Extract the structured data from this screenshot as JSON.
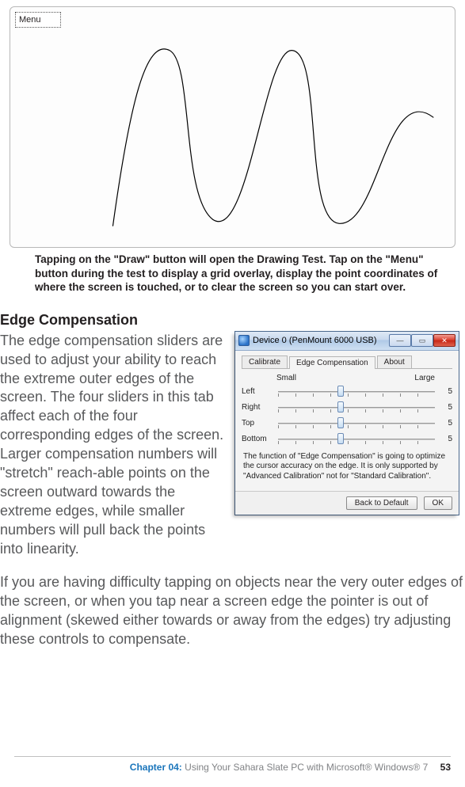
{
  "draw_test": {
    "menu_label": "Menu"
  },
  "caption": "Tapping on the \"Draw\" button will open the Drawing Test. Tap on the \"Menu\" button during the test to display a grid overlay, display the point coordinates of where the screen is touched, or to clear the screen so you can start over.",
  "heading": "Edge Compensation",
  "paragraph1": "The edge compensation sliders are used to adjust your ability to reach the extreme outer edges of the screen. The four sliders in this tab affect each of the four corresponding edges of the screen. Larger compensation numbers will \"stretch\" reach-able points on the screen outward towards the extreme edges, while smaller numbers will pull back the points into linearity.",
  "paragraph2": "If you are having difficulty tapping on objects near the very outer edges of the screen, or when you tap near a screen edge the pointer is out of alignment (skewed either towards or away from the edges) try adjusting these controls to compensate.",
  "dialog": {
    "title": "Device 0 (PenMount 6000 USB)",
    "tabs": {
      "calibrate": "Calibrate",
      "edge": "Edge Compensation",
      "about": "About"
    },
    "scale": {
      "small": "Small",
      "large": "Large"
    },
    "sliders": [
      {
        "label": "Left",
        "value": "5"
      },
      {
        "label": "Right",
        "value": "5"
      },
      {
        "label": "Top",
        "value": "5"
      },
      {
        "label": "Bottom",
        "value": "5"
      }
    ],
    "note": "The function of \"Edge Compensation\" is going to optimize the cursor accuracy on the edge. It is only supported by \"Advanced Calibration\" not for \"Standard Calibration\".",
    "buttons": {
      "back": "Back to Default",
      "ok": "OK"
    }
  },
  "footer": {
    "chapter": "Chapter 04:",
    "title": "  Using Your Sahara Slate PC with Microsoft® Windows® 7",
    "page": "53"
  }
}
